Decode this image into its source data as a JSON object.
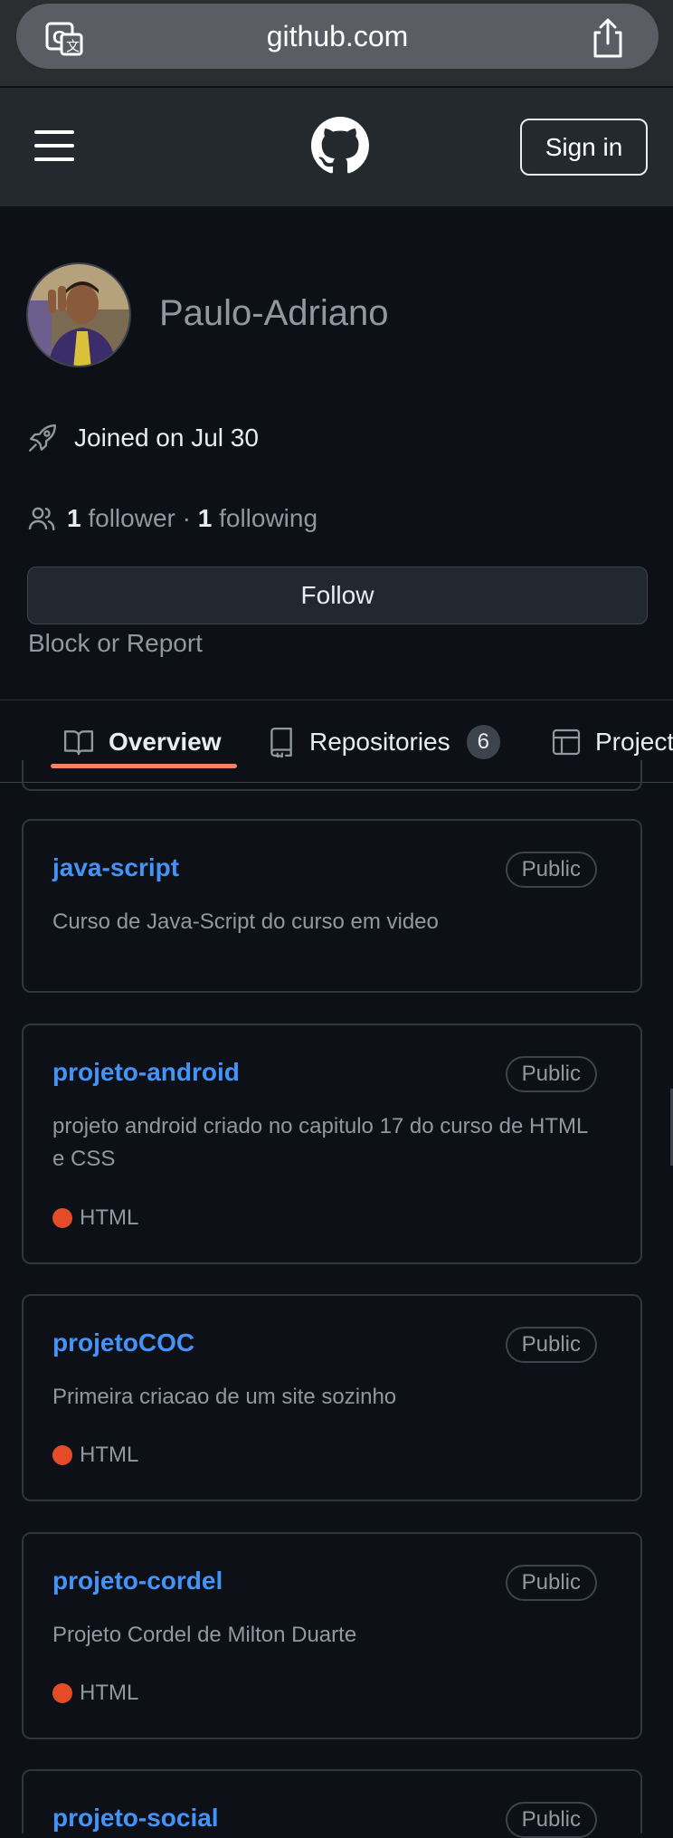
{
  "browser": {
    "url": "github.com",
    "translate_icon": "translate-icon",
    "share_icon": "share-icon"
  },
  "header": {
    "menu_icon": "hamburger-menu-icon",
    "logo_icon": "github-octocat-icon",
    "signin_label": "Sign in"
  },
  "profile": {
    "username": "Paulo-Adriano",
    "joined": "Joined on Jul 30",
    "followers_count": "1",
    "followers_label": "follower",
    "separator": "·",
    "following_count": "1",
    "following_label": "following",
    "follow_button": "Follow",
    "block_report": "Block or Report"
  },
  "tabs": [
    {
      "label": "Overview",
      "icon": "book-icon",
      "selected": true
    },
    {
      "label": "Repositories",
      "icon": "repo-icon",
      "count": "6"
    },
    {
      "label": "Projects",
      "icon": "table-icon"
    }
  ],
  "repos": [
    {
      "name": "java-script",
      "visibility": "Public",
      "description": "Curso de Java-Script do curso em video",
      "language": ""
    },
    {
      "name": "projeto-android",
      "visibility": "Public",
      "description": "projeto android criado no capitulo 17 do curso de HTML e CSS",
      "language": "HTML"
    },
    {
      "name": "projetoCOC",
      "visibility": "Public",
      "description": "Primeira criacao de um site sozinho",
      "language": "HTML"
    },
    {
      "name": "projeto-cordel",
      "visibility": "Public",
      "description": "Projeto Cordel de Milton Duarte",
      "language": "HTML"
    },
    {
      "name": "projeto-social",
      "visibility": "Public",
      "description": "",
      "language": ""
    }
  ],
  "colors": {
    "background": "#0d1117",
    "header": "#24292f",
    "link": "#4493f8",
    "muted": "#9198a1",
    "tab_underline": "#f78166",
    "html_language": "#e34c26"
  }
}
